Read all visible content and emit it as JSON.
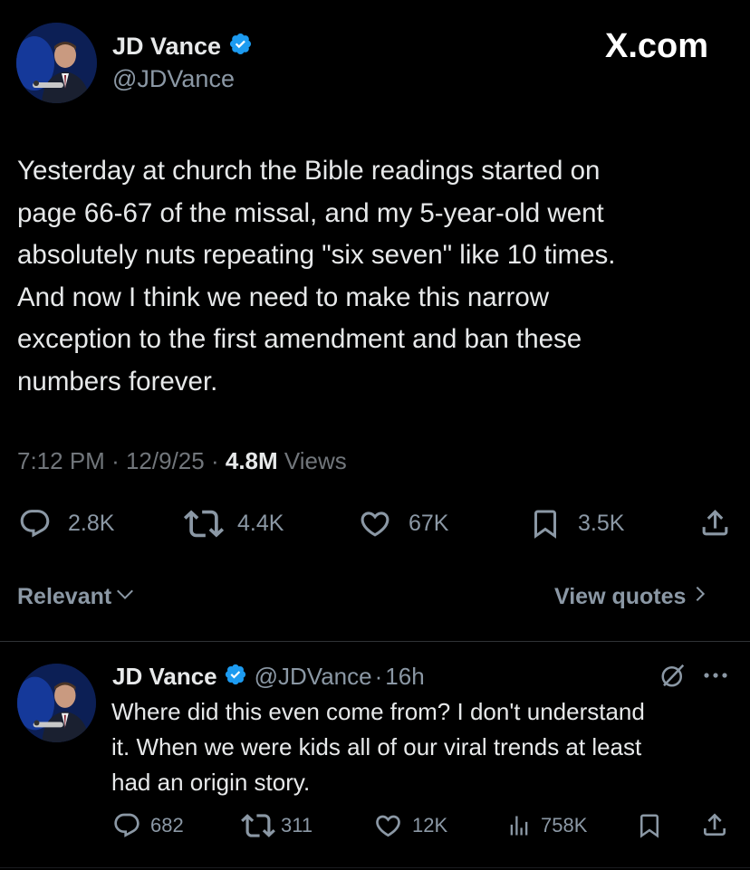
{
  "brand": {
    "site": "X.com"
  },
  "tweet": {
    "author_name": "JD Vance",
    "author_handle": "@JDVance",
    "text_lines": [
      "Yesterday at church the Bible readings started on",
      "page 66-67 of the missal, and my 5-year-old went",
      "absolutely nuts repeating \"six seven\" like 10 times.",
      "And now I think we need to make this narrow",
      "exception to the first amendment and ban these",
      "numbers forever."
    ],
    "time": "7:12 PM",
    "date": "12/9/25",
    "views_count": "4.8M",
    "views_label": "Views",
    "separator": "·",
    "stats": {
      "replies": "2.8K",
      "reposts": "4.4K",
      "likes": "67K",
      "bookmarks": "3.5K"
    }
  },
  "filters": {
    "sort_label": "Relevant",
    "quotes_label": "View quotes"
  },
  "reply": {
    "author_name": "JD Vance",
    "author_handle": "@JDVance",
    "separator": "·",
    "time": "16h",
    "text_lines": [
      "Where did this even come from? I don't understand",
      "it. When we were kids all of our viral trends at least",
      "had an origin story."
    ],
    "stats": {
      "replies": "682",
      "reposts": "311",
      "likes": "12K",
      "views": "758K"
    }
  },
  "icons": {
    "verified": "verified-badge-icon",
    "reply": "reply-icon",
    "repost": "repost-icon",
    "like": "heart-icon",
    "bookmark": "bookmark-icon",
    "share": "share-icon",
    "views": "views-icon",
    "grok": "grok-icon",
    "more": "more-icon"
  },
  "colors": {
    "background": "#000000",
    "text": "#e7e9ea",
    "muted": "#71767b",
    "verified": "#1d9bf0"
  }
}
